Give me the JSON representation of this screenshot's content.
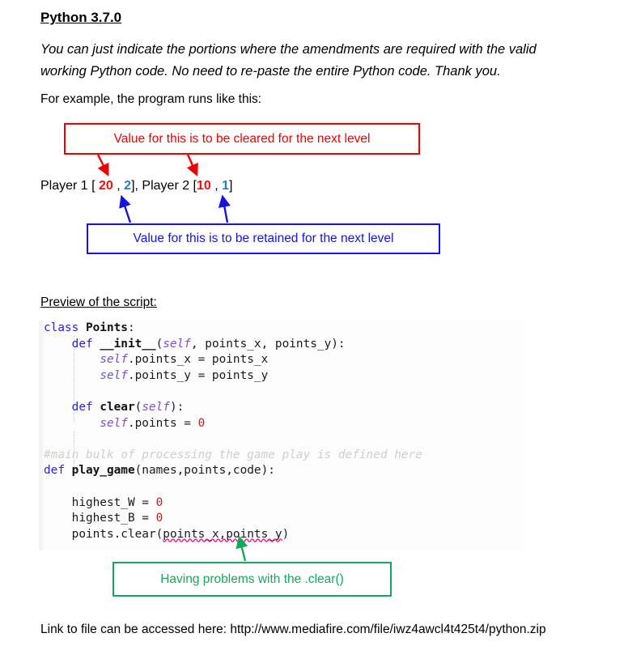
{
  "document": {
    "heading": "Python 3.7.0",
    "intro_paragraph": "You can just indicate the portions where the amendments are required with the valid working Python code. No need to re-paste the entire Python code. Thank you.",
    "example_intro": "For example, the program runs like this:",
    "preview_label": "Preview of the script:",
    "link_line": "Link to file can be accessed here: http://www.mediafire.com/file/iwz4awcl4t425t4/python.zip"
  },
  "sample_output": {
    "prefix": "Player 1 [ ",
    "p1_cleared_value": "20",
    "sep1": " , ",
    "p1_retained_value": "2",
    "middle": "], Player 2 [",
    "p2_cleared_value": "10",
    "sep2": " , ",
    "p2_retained_value": "1",
    "suffix": "]"
  },
  "annotations": {
    "red": {
      "text": "Value for this is to be cleared for the next level",
      "color": "#ee0000"
    },
    "blue": {
      "text": "Value for this is to be retained for the next level",
      "color": "#1414dd"
    },
    "green": {
      "text": "Having problems with the .clear()",
      "color": "#16a85a"
    }
  },
  "code": {
    "lines": [
      {
        "tokens": [
          {
            "t": "class ",
            "c": "kw"
          },
          {
            "t": "Points",
            "c": "name"
          },
          {
            "t": ":",
            "c": "plain"
          }
        ]
      },
      {
        "tokens": [
          {
            "t": "    ",
            "c": "plain"
          },
          {
            "t": "def ",
            "c": "kw"
          },
          {
            "t": "__init__",
            "c": "name"
          },
          {
            "t": "(",
            "c": "plain"
          },
          {
            "t": "self",
            "c": "slf"
          },
          {
            "t": ", points_x, points_y):",
            "c": "plain"
          }
        ]
      },
      {
        "tokens": [
          {
            "t": "        ",
            "c": "plain"
          },
          {
            "t": "self",
            "c": "slf"
          },
          {
            "t": ".points_x = points_x",
            "c": "plain"
          }
        ]
      },
      {
        "tokens": [
          {
            "t": "        ",
            "c": "plain"
          },
          {
            "t": "self",
            "c": "slf"
          },
          {
            "t": ".points_y = points_y",
            "c": "plain"
          }
        ]
      },
      {
        "tokens": []
      },
      {
        "tokens": [
          {
            "t": "    ",
            "c": "plain"
          },
          {
            "t": "def ",
            "c": "kw"
          },
          {
            "t": "clear",
            "c": "name"
          },
          {
            "t": "(",
            "c": "plain"
          },
          {
            "t": "self",
            "c": "slf"
          },
          {
            "t": "):",
            "c": "plain"
          }
        ]
      },
      {
        "tokens": [
          {
            "t": "        ",
            "c": "plain"
          },
          {
            "t": "self",
            "c": "slf"
          },
          {
            "t": ".points = ",
            "c": "plain"
          },
          {
            "t": "0",
            "c": "num"
          }
        ]
      },
      {
        "tokens": []
      },
      {
        "tokens": [
          {
            "t": "#main bulk of processing the game play is defined here",
            "c": "cmt"
          }
        ]
      },
      {
        "tokens": [
          {
            "t": "def ",
            "c": "kw"
          },
          {
            "t": "play_game",
            "c": "name"
          },
          {
            "t": "(names,points,code):",
            "c": "plain"
          }
        ]
      },
      {
        "tokens": []
      },
      {
        "tokens": [
          {
            "t": "    highest_W = ",
            "c": "plain"
          },
          {
            "t": "0",
            "c": "num"
          }
        ]
      },
      {
        "tokens": [
          {
            "t": "    highest_B = ",
            "c": "plain"
          },
          {
            "t": "0",
            "c": "num"
          }
        ]
      },
      {
        "tokens": [
          {
            "t": "    points.clear(",
            "c": "plain"
          },
          {
            "t": "points_x,points_y",
            "c": "plain squiggle"
          },
          {
            "t": ")",
            "c": "plain"
          }
        ]
      }
    ]
  }
}
